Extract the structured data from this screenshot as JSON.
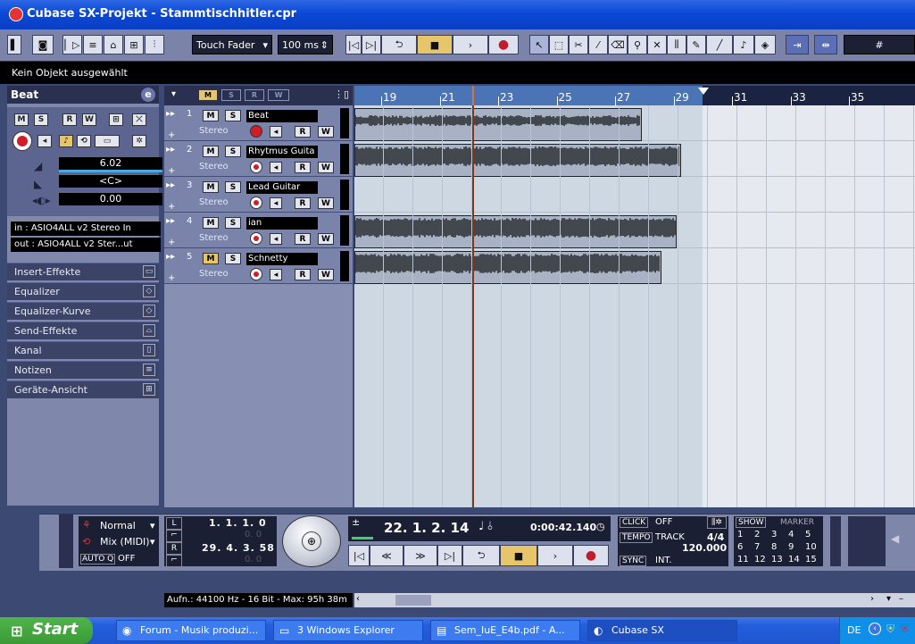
{
  "window": {
    "title": "Cubase SX-Projekt - Stammtischhitler.cpr"
  },
  "toolbar": {
    "automation_mode": "Touch Fader",
    "autoquant_time": "100 ms"
  },
  "status_line": "Kein Objekt ausgewählt",
  "inspector": {
    "track_name": "Beat",
    "volume": "6.02",
    "pan": "<C>",
    "delay": "0.00",
    "input": "in : ASIO4ALL v2 Stereo In",
    "output": "out : ASIO4ALL v2 Ster...ut",
    "sections": [
      "Insert-Effekte",
      "Equalizer",
      "Equalizer-Kurve",
      "Send-Effekte",
      "Kanal",
      "Notizen",
      "Geräte-Ansicht"
    ]
  },
  "tracks": [
    {
      "num": "1",
      "name": "Beat",
      "type": "Stereo",
      "mute_label": "M",
      "solo_label": "S",
      "read_label": "R",
      "write_label": "W"
    },
    {
      "num": "2",
      "name": "Rhytmus Guita",
      "type": "Stereo",
      "mute_label": "M",
      "solo_label": "S",
      "read_label": "R",
      "write_label": "W"
    },
    {
      "num": "3",
      "name": "Lead Guitar",
      "type": "Stereo",
      "mute_label": "M",
      "solo_label": "S",
      "read_label": "R",
      "write_label": "W"
    },
    {
      "num": "4",
      "name": "ian",
      "type": "Stereo",
      "mute_label": "M",
      "solo_label": "S",
      "read_label": "R",
      "write_label": "W"
    },
    {
      "num": "5",
      "name": "Schnetty",
      "type": "Stereo",
      "mute_label": "M",
      "solo_label": "S",
      "read_label": "R",
      "write_label": "W"
    }
  ],
  "ruler": {
    "bars": [
      "19",
      "21",
      "23",
      "25",
      "27",
      "29",
      "31",
      "33",
      "35"
    ]
  },
  "transport": {
    "mode": "Normal",
    "mix": "Mix (MIDI)",
    "autoq_label": "AUTO Q",
    "autoq_value": "OFF",
    "left_locator": "1. 1. 1. 0",
    "left_sub": "0. 0",
    "right_locator": "29. 4. 3. 58",
    "right_sub": "0. 0",
    "position_bars": "22. 1. 2. 14",
    "position_time": "0:00:42.140",
    "click_label": "CLICK",
    "click_value": "OFF",
    "tempo_label": "TEMPO",
    "tempo_mode": "TRACK",
    "signature": "4/4",
    "tempo_value": "120.000",
    "sync_label": "SYNC",
    "sync_value": "INT.",
    "show_label": "SHOW",
    "marker_label": "MARKER",
    "markers": [
      "1",
      "2",
      "3",
      "4",
      "5",
      "6",
      "7",
      "8",
      "9",
      "10",
      "11",
      "12",
      "13",
      "14",
      "15"
    ]
  },
  "record_info": "Aufn.: 44100 Hz - 16 Bit - Max: 95h 38m",
  "taskbar": {
    "start": "Start",
    "items": [
      "Forum - Musik produzi...",
      "3 Windows Explorer",
      "Sem_IuE_E4b.pdf - A...",
      "Cubase SX"
    ],
    "language": "DE"
  }
}
